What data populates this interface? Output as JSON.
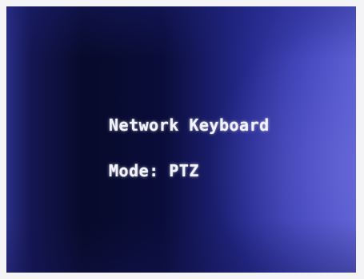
{
  "osd": {
    "title": "Network Keyboard",
    "mode": "Mode: PTZ"
  }
}
